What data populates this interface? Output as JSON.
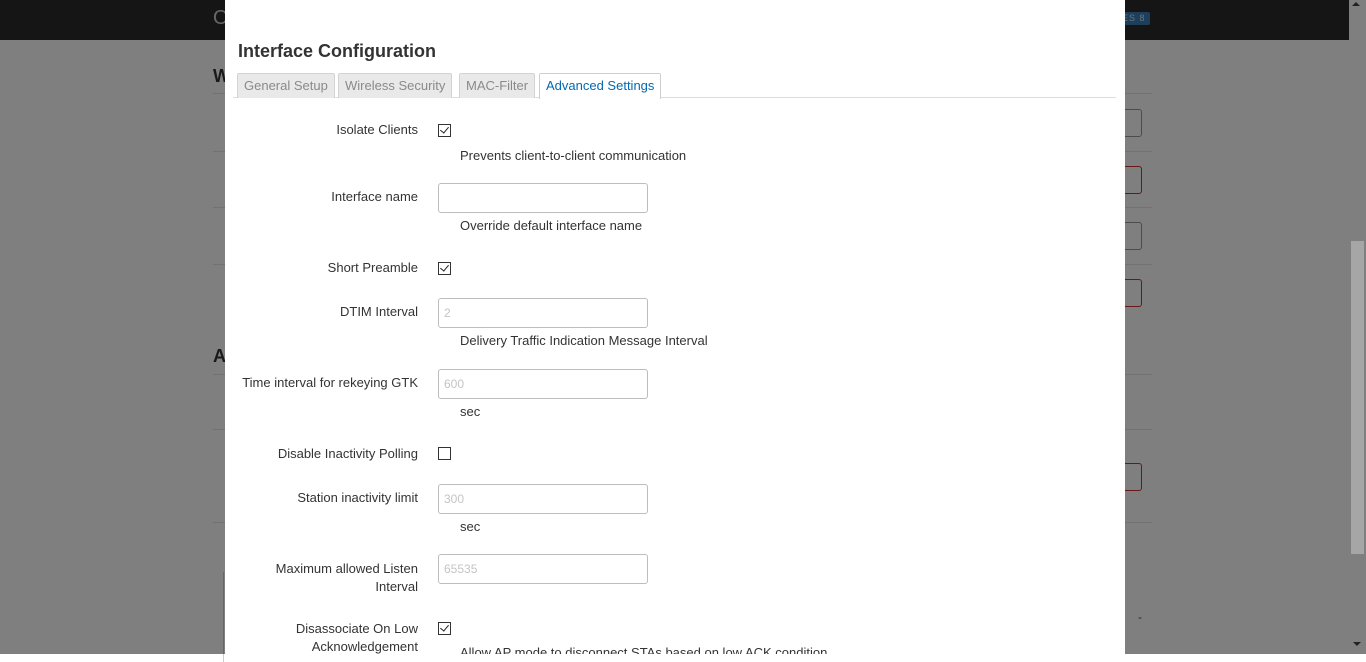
{
  "background": {
    "brand": "O",
    "badge": "ES 8",
    "heading_w": "W",
    "heading_a": "A"
  },
  "modal": {
    "title": "Interface Configuration",
    "tabs": [
      {
        "label": "General Setup",
        "active": false
      },
      {
        "label": "Wireless Security",
        "active": false
      },
      {
        "label": "MAC-Filter",
        "active": false
      },
      {
        "label": "Advanced Settings",
        "active": true
      }
    ],
    "fields": {
      "isolate_clients": {
        "label": "Isolate Clients",
        "checked": true,
        "description": "Prevents client-to-client communication"
      },
      "interface_name": {
        "label": "Interface name",
        "value": "",
        "placeholder": "",
        "description": "Override default interface name"
      },
      "short_preamble": {
        "label": "Short Preamble",
        "checked": true
      },
      "dtim_interval": {
        "label": "DTIM Interval",
        "value": "",
        "placeholder": "2",
        "description": "Delivery Traffic Indication Message Interval"
      },
      "rekey_gtk": {
        "label": "Time interval for rekeying GTK",
        "value": "",
        "placeholder": "600",
        "description": "sec"
      },
      "disable_inactivity_polling": {
        "label": "Disable Inactivity Polling",
        "checked": false
      },
      "station_inactivity_limit": {
        "label": "Station inactivity limit",
        "value": "",
        "placeholder": "300",
        "description": "sec"
      },
      "max_listen_interval": {
        "label_line1": "Maximum allowed Listen",
        "label_line2": "Interval",
        "value": "",
        "placeholder": "65535"
      },
      "disassoc_low_ack": {
        "label_line1": "Disassociate On Low",
        "label_line2": "Acknowledgement",
        "checked": true,
        "description": "Allow AP mode to disconnect STAs based on low ACK condition"
      }
    }
  }
}
